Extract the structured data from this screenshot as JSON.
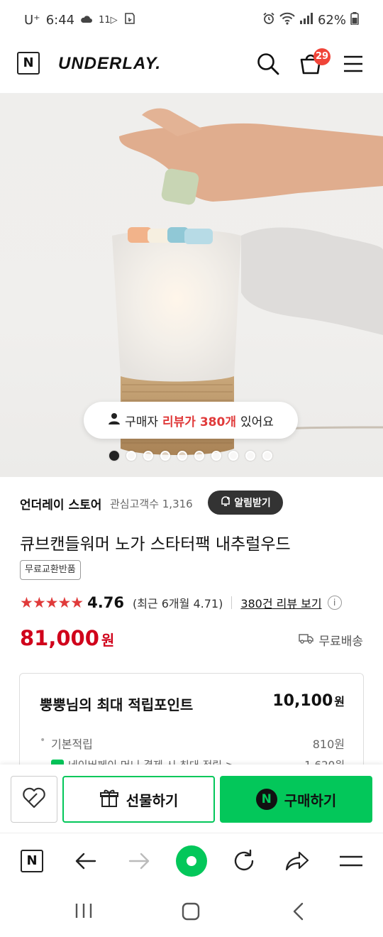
{
  "status_bar": {
    "carrier": "U⁺",
    "time": "6:44",
    "extra": "11▷",
    "battery": "62%"
  },
  "header": {
    "brand": "UNDERLAY.",
    "logo_letter": "N",
    "cart_count": "29"
  },
  "hero": {
    "review_prefix": "구매자",
    "review_highlight": "리뷰가 380개",
    "review_suffix": "있어요",
    "carousel_total": 10,
    "carousel_active": 1
  },
  "store": {
    "name": "언더레이 스토어",
    "watchers": "관심고객수 1,316",
    "alarm_label": "알림받기"
  },
  "product": {
    "title": "큐브캔들워머 노가 스타터팩 내추럴우드",
    "tag": "무료교환반품",
    "stars": "★★★★★",
    "rating": "4.76",
    "recent_rating": "(최근 6개월 4.71)",
    "review_link": "380건 리뷰 보기",
    "price": "81,000",
    "price_unit": "원",
    "shipping": "무료배송"
  },
  "points": {
    "title": "뿡뿡님의 최대 적립포인트",
    "total": "10,100",
    "total_unit": "원",
    "basic_label": "기본적립",
    "basic_value": "810원",
    "npay_label": "네이버페이 머니 결제 시 최대 적립 >",
    "npay_value": "1,620원"
  },
  "actions": {
    "gift_label": "선물하기",
    "buy_label": "구매하기",
    "buy_logo": "N"
  },
  "colors": {
    "accent_green": "#03c75a",
    "price_red": "#d0021b",
    "star_red": "#e03a3a",
    "badge_red": "#f04438"
  }
}
